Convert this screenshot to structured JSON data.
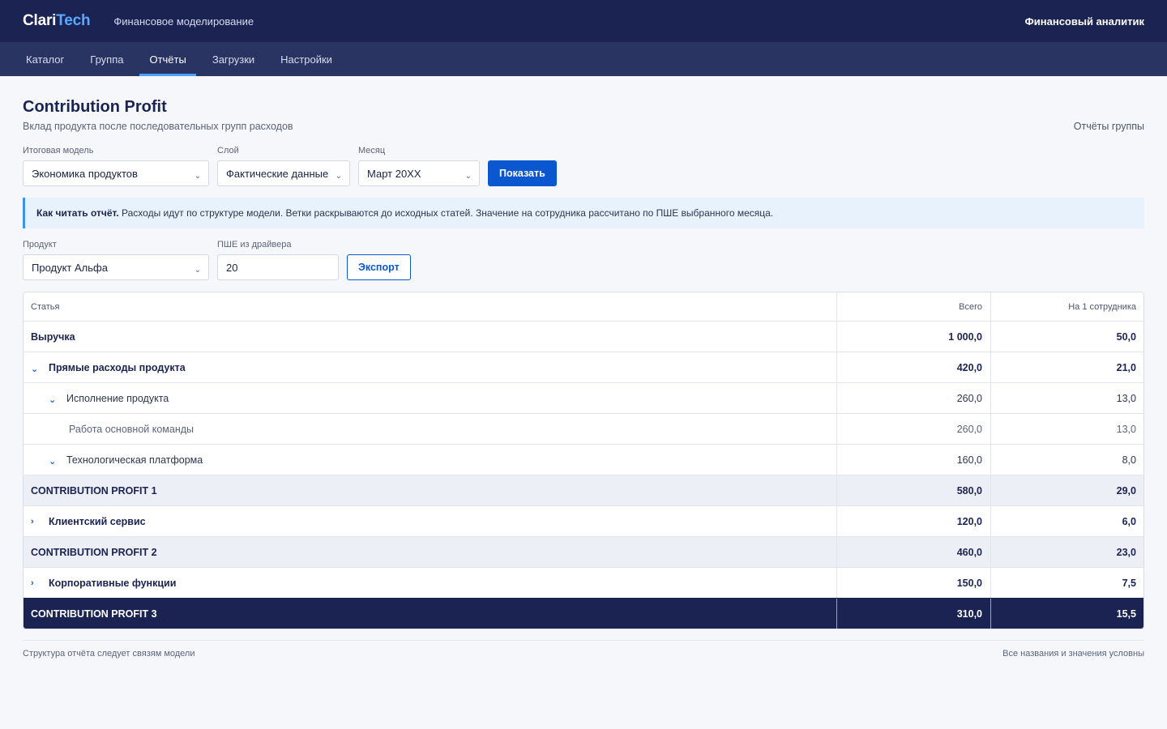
{
  "header": {
    "logo_part1": "Clari",
    "logo_part2": "Tech",
    "app_title": "Финансовое моделирование",
    "user_role": "Финансовый аналитик"
  },
  "nav": {
    "tabs": [
      {
        "label": "Каталог"
      },
      {
        "label": "Группа"
      },
      {
        "label": "Отчёты",
        "active": true
      },
      {
        "label": "Загрузки"
      },
      {
        "label": "Настройки"
      }
    ]
  },
  "page": {
    "title": "Contribution Profit",
    "subtitle": "Вклад продукта после последовательных групп расходов",
    "group_reports_link": "Отчёты группы"
  },
  "filters": {
    "model_label": "Итоговая модель",
    "model_value": "Экономика продуктов",
    "layer_label": "Слой",
    "layer_value": "Фактические данные",
    "month_label": "Месяц",
    "month_value": "Март 20XX",
    "show_button": "Показать"
  },
  "info": {
    "title": "Как читать отчёт.",
    "text": "Расходы идут по структуре модели. Ветки раскрываются до исходных статей. Значение на сотрудника рассчитано по ПШЕ выбранного месяца."
  },
  "filters2": {
    "product_label": "Продукт",
    "product_value": "Продукт Альфа",
    "fte_label": "ПШЕ из драйвера",
    "fte_value": "20",
    "export_button": "Экспорт"
  },
  "table": {
    "columns": [
      "Статья",
      "Всего",
      "На 1 сотрудника"
    ],
    "rows": [
      {
        "label": "Выручка",
        "total": "1 000,0",
        "per_employee": "50,0"
      },
      {
        "label": "Прямые расходы продукта",
        "total": "420,0",
        "per_employee": "21,0",
        "toggle": "⌄"
      },
      {
        "label": "Исполнение продукта",
        "total": "260,0",
        "per_employee": "13,0",
        "toggle": "⌄"
      },
      {
        "label": "Работа основной команды",
        "total": "260,0",
        "per_employee": "13,0"
      },
      {
        "label": "Технологическая платформа",
        "total": "160,0",
        "per_employee": "8,0",
        "toggle": "⌄"
      },
      {
        "label": "CONTRIBUTION PROFIT 1",
        "total": "580,0",
        "per_employee": "29,0"
      },
      {
        "label": "Клиентский сервис",
        "total": "120,0",
        "per_employee": "6,0",
        "toggle": "›"
      },
      {
        "label": "CONTRIBUTION PROFIT 2",
        "total": "460,0",
        "per_employee": "23,0"
      },
      {
        "label": "Корпоративные функции",
        "total": "150,0",
        "per_employee": "7,5",
        "toggle": "›"
      },
      {
        "label": "CONTRIBUTION PROFIT 3",
        "total": "310,0",
        "per_employee": "15,5"
      }
    ]
  },
  "footer": {
    "left": "Структура отчёта следует связям модели",
    "right": "Все названия и значения условны"
  },
  "colors": {
    "header_bg": "#1b2352",
    "nav_bg": "#2a3463",
    "accent": "#0b57d0",
    "logo_accent": "#5aa8ff",
    "info_bg": "#e8f2fd"
  }
}
